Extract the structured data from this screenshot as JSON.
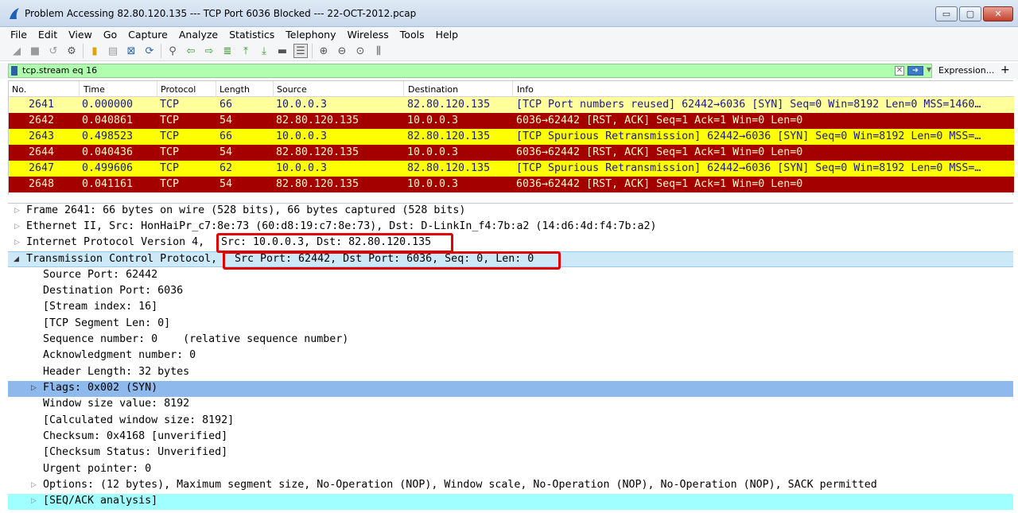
{
  "window": {
    "title": "Problem Accessing 82.80.120.135 --- TCP Port 6036 Blocked --- 22-OCT-2012.pcap",
    "minimize_label": "▭",
    "maximize_label": "▢",
    "close_label": "✕"
  },
  "menu": [
    "File",
    "Edit",
    "View",
    "Go",
    "Capture",
    "Analyze",
    "Statistics",
    "Telephony",
    "Wireless",
    "Tools",
    "Help"
  ],
  "toolbar_icons": [
    "start-capture-icon",
    "stop-capture-icon",
    "restart-capture-icon",
    "capture-options-icon",
    "open-file-icon",
    "save-file-icon",
    "close-file-icon",
    "reload-file-icon",
    "find-packet-icon",
    "go-back-icon",
    "go-forward-icon",
    "go-to-packet-icon",
    "go-first-icon",
    "go-last-icon",
    "auto-scroll-icon",
    "colorize-icon",
    "zoom-in-icon",
    "zoom-out-icon",
    "zoom-normal-icon",
    "resize-columns-icon"
  ],
  "filter": {
    "value": "tcp.stream eq 16",
    "expression_label": "Expression...",
    "plus_label": "+",
    "color": "#afffaf"
  },
  "packet_list": {
    "columns": [
      "No.",
      "Time",
      "Protocol",
      "Length",
      "Source",
      "Destination",
      "Info"
    ],
    "rows": [
      {
        "no": "2641",
        "time": "0.000000",
        "protocol": "TCP",
        "length": "66",
        "source": "10.0.0.3",
        "destination": "82.80.120.135",
        "info": "[TCP Port numbers reused] 62442→6036 [SYN] Seq=0 Win=8192 Len=0 MSS=1460…",
        "color": "yellow",
        "selected": true
      },
      {
        "no": "2642",
        "time": "0.040861",
        "protocol": "TCP",
        "length": "54",
        "source": "82.80.120.135",
        "destination": "10.0.0.3",
        "info": "6036→62442 [RST, ACK] Seq=1 Ack=1 Win=0 Len=0",
        "color": "red",
        "selected": false
      },
      {
        "no": "2643",
        "time": "0.498523",
        "protocol": "TCP",
        "length": "66",
        "source": "10.0.0.3",
        "destination": "82.80.120.135",
        "info": "[TCP Spurious Retransmission] 62442→6036 [SYN] Seq=0 Win=8192 Len=0 MSS=…",
        "color": "yellow",
        "selected": false
      },
      {
        "no": "2644",
        "time": "0.040436",
        "protocol": "TCP",
        "length": "54",
        "source": "82.80.120.135",
        "destination": "10.0.0.3",
        "info": "6036→62442 [RST, ACK] Seq=1 Ack=1 Win=0 Len=0",
        "color": "red",
        "selected": false
      },
      {
        "no": "2647",
        "time": "0.499606",
        "protocol": "TCP",
        "length": "62",
        "source": "10.0.0.3",
        "destination": "82.80.120.135",
        "info": "[TCP Spurious Retransmission] 62442→6036 [SYN] Seq=0 Win=8192 Len=0 MSS=…",
        "color": "yellow",
        "selected": false
      },
      {
        "no": "2648",
        "time": "0.041161",
        "protocol": "TCP",
        "length": "54",
        "source": "82.80.120.135",
        "destination": "10.0.0.3",
        "info": "6036→62442 [RST, ACK] Seq=1 Ack=1 Win=0 Len=0",
        "color": "red",
        "selected": false
      }
    ]
  },
  "details": {
    "frame": "Frame 2641: 66 bytes on wire (528 bits), 66 bytes captured (528 bits)",
    "ethernet": "Ethernet II, Src: HonHaiPr_c7:8e:73 (60:d8:19:c7:8e:73), Dst: D-LinkIn_f4:7b:a2 (14:d6:4d:f4:7b:a2)",
    "ip_prefix": "Internet Protocol Version 4, ",
    "ip_addresses": "Src: 10.0.0.3, Dst: 82.80.120.135",
    "tcp_prefix": "Transmission Control Protocol, ",
    "tcp_summary": "Src Port: 62442, Dst Port: 6036, Seq: 0, Len: 0",
    "tcp_fields": {
      "source_port": "Source Port: 62442",
      "destination_port": "Destination Port: 6036",
      "stream_index": "[Stream index: 16]",
      "segment_len": "[TCP Segment Len: 0]",
      "sequence_number": "Sequence number: 0    (relative sequence number)",
      "ack_number": "Acknowledgment number: 0",
      "header_length": "Header Length: 32 bytes",
      "flags": "Flags: 0x002 (SYN)",
      "window_size": "Window size value: 8192",
      "calc_window": "[Calculated window size: 8192]",
      "checksum": "Checksum: 0x4168 [unverified]",
      "checksum_status": "[Checksum Status: Unverified]",
      "urgent_pointer": "Urgent pointer: 0",
      "options": "Options: (12 bytes), Maximum segment size, No-Operation (NOP), Window scale, No-Operation (NOP), No-Operation (NOP), SACK permitted",
      "seq_ack_analysis": "[SEQ/ACK analysis]"
    }
  },
  "colors": {
    "syn_row": "#ffff00",
    "rst_row": "#a40000",
    "annotation_box": "#e00000"
  }
}
